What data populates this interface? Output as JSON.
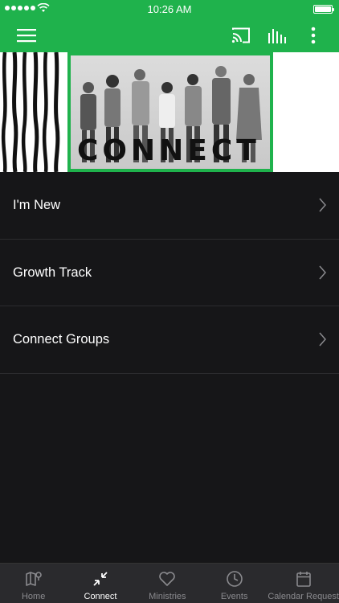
{
  "status_bar": {
    "time": "10:26 AM"
  },
  "app_bar": {
    "icons": [
      "menu-icon",
      "cast-icon",
      "audio-bars-icon",
      "more-vertical-icon"
    ]
  },
  "banner": {
    "title": "CONNECT"
  },
  "menu": {
    "items": [
      {
        "label": "I'm New"
      },
      {
        "label": "Growth Track"
      },
      {
        "label": "Connect Groups"
      }
    ]
  },
  "tab_bar": {
    "items": [
      {
        "label": "Home",
        "icon": "map-icon",
        "active": false
      },
      {
        "label": "Connect",
        "icon": "compress-arrows-icon",
        "active": true
      },
      {
        "label": "Ministries",
        "icon": "heart-icon",
        "active": false
      },
      {
        "label": "Events",
        "icon": "clock-icon",
        "active": false
      },
      {
        "label": "Calendar Request",
        "icon": "calendar-icon",
        "active": false
      }
    ]
  },
  "colors": {
    "brand": "#1fb24c",
    "background": "#161618",
    "tab_bar": "#2a2a2d"
  }
}
